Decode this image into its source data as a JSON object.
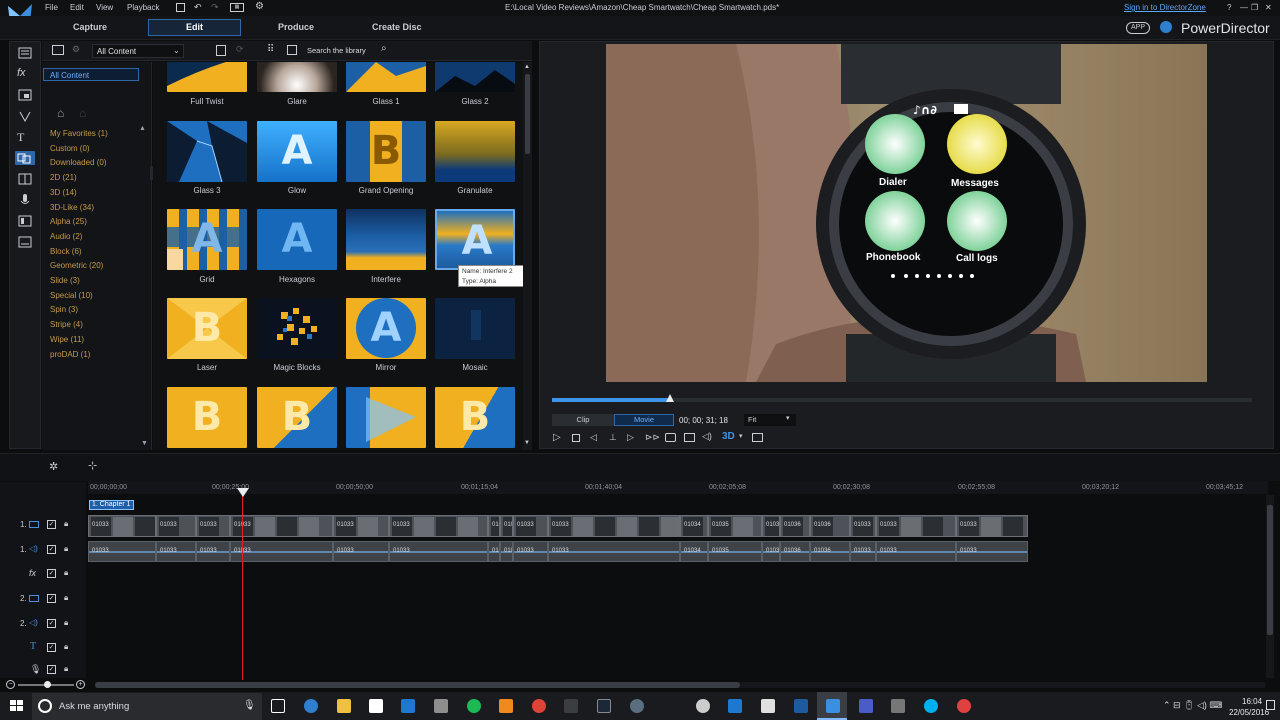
{
  "menu": {
    "file": "File",
    "edit": "Edit",
    "view": "View",
    "playback": "Playback"
  },
  "window": {
    "title": "E:\\Local Video Reviews\\Amazon\\Cheap Smartwatch\\Cheap Smartwatch.pds*",
    "sign_in": "Sign in to DirectorZone",
    "app_name": "PowerDirector",
    "app_badge": "APP",
    "help": "?"
  },
  "modes": {
    "capture": "Capture",
    "edit": "Edit",
    "produce": "Produce",
    "create_disc": "Create Disc"
  },
  "library": {
    "filter": "All Content",
    "search_placeholder": "Search the library",
    "tree_selected": "All Content"
  },
  "categories": [
    "My Favorites  (1)",
    "Custom  (0)",
    "Downloaded  (0)",
    "2D  (21)",
    "3D  (14)",
    "3D-Like  (34)",
    "Alpha  (25)",
    "Audio  (2)",
    "Block  (6)",
    "Geometric  (20)",
    "Slide  (3)",
    "Special  (10)",
    "Spin  (3)",
    "Stripe  (4)",
    "Wipe  (11)",
    "proDAD  (1)"
  ],
  "transitions": {
    "row0": [
      "Full Twist",
      "Glare",
      "Glass 1",
      "Glass 2"
    ],
    "row1": [
      "Glass 3",
      "Glow",
      "Grand Opening",
      "Granulate"
    ],
    "row2": [
      "Grid",
      "Hexagons",
      "Interfere",
      ""
    ],
    "row3": [
      "Laser",
      "Magic Blocks",
      "Mirror",
      "Mosaic"
    ]
  },
  "tooltip": {
    "name": "Name: Interfere 2",
    "type": "Type: Alpha"
  },
  "watch": {
    "dialer": "Dialer",
    "messages": "Messages",
    "phonebook": "Phonebook",
    "call_logs": "Call logs"
  },
  "player": {
    "clip": "Clip",
    "movie": "Movie",
    "timecode": "00; 00; 31; 18",
    "fit": "Fit",
    "threed": "3D",
    "scrub_progress": 0.2
  },
  "ruler": [
    "00;00;00;00",
    "00;00;25;00",
    "00;00;50;00",
    "00;01;15;04",
    "00;01;40;04",
    "00;02;05;08",
    "00;02;30;08",
    "00;02;55;08",
    "00;03;20;12",
    "00;03;45;12"
  ],
  "chapter": "1. Chapter 1",
  "tracks": {
    "v1": "1.",
    "a1": "1.",
    "v2": "2.",
    "a2": "2."
  },
  "clips": [
    "01033",
    "01033",
    "01033",
    "01033",
    "01033",
    "01033",
    "01033",
    "01033",
    "01033",
    "01033",
    "01034",
    "01035",
    "01035",
    "01036",
    "01036"
  ],
  "taskbar": {
    "search": "Ask me anything",
    "time": "16:04",
    "date": "22/05/2016"
  },
  "colors": {
    "accent": "#2f7fd0",
    "gold": "#f0b020",
    "blue": "#1f7fd8",
    "playhead": "#e02020",
    "category": "#c79a4a"
  }
}
